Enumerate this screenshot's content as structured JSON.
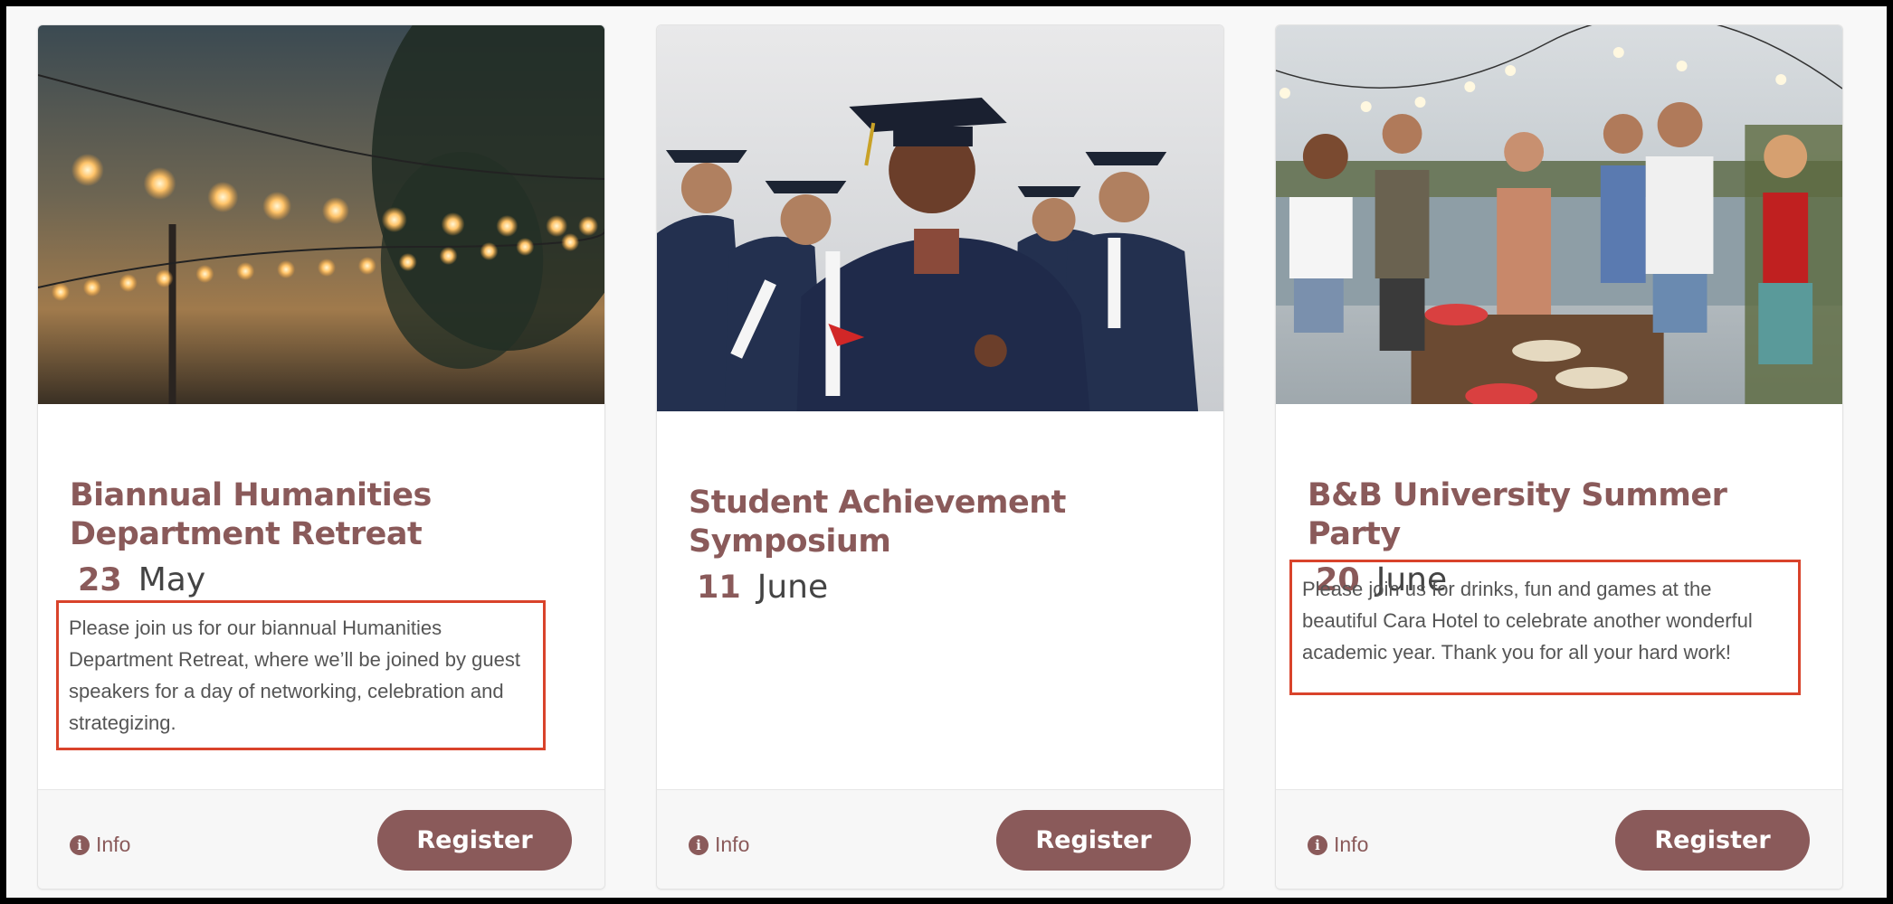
{
  "events": [
    {
      "title": "Biannual Humanities Department Retreat",
      "day": "23",
      "month": "May",
      "description": "Please join us for our biannual Humanities Department Retreat, where we’ll be joined by guest speakers for a day of networking, celebration and strategizing.",
      "info_label": "Info",
      "register_label": "Register"
    },
    {
      "title": "Student Achievement Symposium",
      "day": "11",
      "month": "June",
      "description": "",
      "info_label": "Info",
      "register_label": "Register"
    },
    {
      "title": "B&B University Summer Party",
      "day": "20",
      "month": "June",
      "description": "Please join us for drinks, fun and games at the beautiful Cara Hotel to celebrate another wonderful academic year. Thank you for all your hard work!",
      "info_label": "Info",
      "register_label": "Register"
    }
  ],
  "colors": {
    "accent": "#8a5a5a",
    "highlight_box": "#d9432b",
    "page_background": "#f8f8f8"
  },
  "icons": {
    "info": "info-circle-icon"
  }
}
